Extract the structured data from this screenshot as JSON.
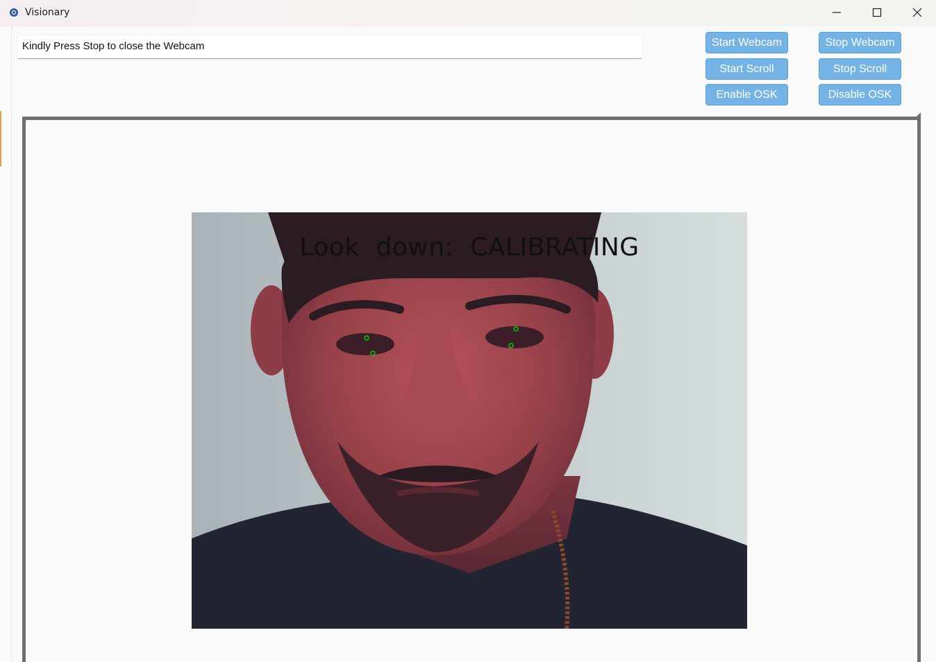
{
  "window": {
    "title": "Visionary",
    "controls": [
      "minimize-icon",
      "maximize-icon",
      "close-icon"
    ]
  },
  "status": {
    "message": "Kindly Press Stop to close the Webcam"
  },
  "buttons": {
    "start_webcam": "Start Webcam",
    "stop_webcam": "Stop Webcam",
    "start_scroll": "Start Scroll",
    "stop_scroll": "Stop Scroll",
    "enable_osk": "Enable OSK",
    "disable_osk": "Disable OSK"
  },
  "video": {
    "overlay_text": "Look  down:  CALIBRATING",
    "landmark_color": "#00d000"
  },
  "colors": {
    "button_bg": "#74b3e6",
    "frame_border": "#6f6f6f"
  }
}
